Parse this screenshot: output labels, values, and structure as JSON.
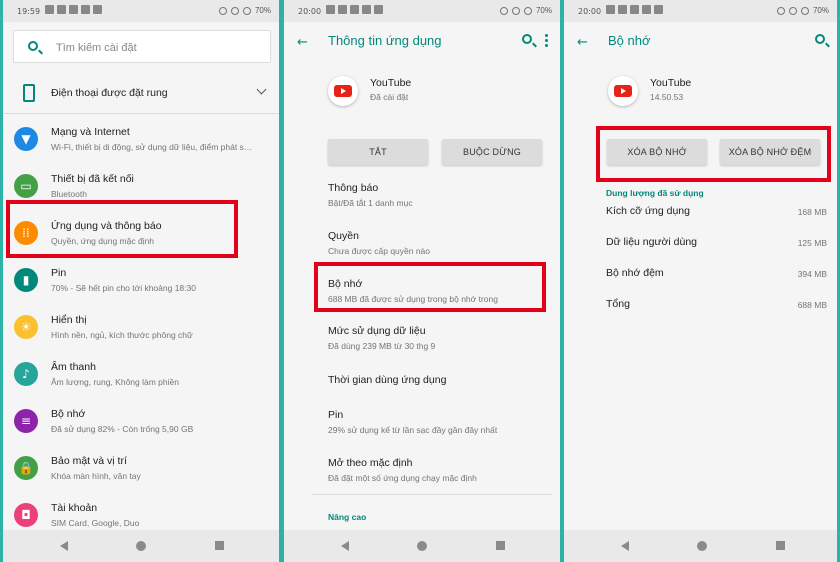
{
  "panel1": {
    "status": {
      "time": "19:59",
      "battery": "70%"
    },
    "search_placeholder": "Tìm kiếm cài đặt",
    "vibrate_label": "Điện thoại được đặt rung",
    "items": [
      {
        "title": "Mạng và Internet",
        "sub": "Wi-Fi, thiết bị di động, sử dụng dữ liệu, điểm phát s…",
        "color": "#1e88e5",
        "icon": "wifi-icon",
        "glyph": "▼"
      },
      {
        "title": "Thiết bị đã kết nối",
        "sub": "Bluetooth",
        "color": "#43a047",
        "icon": "devices-icon",
        "glyph": "▭"
      },
      {
        "title": "Ứng dụng và thông báo",
        "sub": "Quyền, ứng dụng mặc định",
        "color": "#fb8c00",
        "icon": "apps-icon",
        "glyph": "⁞⁞"
      },
      {
        "title": "Pin",
        "sub": "70% - Sẽ hết pin cho tới khoảng 18:30",
        "color": "#00897b",
        "icon": "battery-icon",
        "glyph": "▮"
      },
      {
        "title": "Hiển thị",
        "sub": "Hình nền, ngủ, kích thước phông chữ",
        "color": "#fbc02d",
        "icon": "display-icon",
        "glyph": "☀"
      },
      {
        "title": "Âm thanh",
        "sub": "Âm lượng, rung, Không làm phiền",
        "color": "#26a69a",
        "icon": "sound-icon",
        "glyph": "♪"
      },
      {
        "title": "Bộ nhớ",
        "sub": "Đã sử dụng 82% - Còn trống 5,90 GB",
        "color": "#8e24aa",
        "icon": "storage-icon",
        "glyph": "≡"
      },
      {
        "title": "Bảo mật và vị trí",
        "sub": "Khóa màn hình, vân tay",
        "color": "#43a047",
        "icon": "lock-icon",
        "glyph": "🔒"
      },
      {
        "title": "Tài khoản",
        "sub": "SIM Card, Google, Duo",
        "color": "#ec407a",
        "icon": "account-icon",
        "glyph": "◘"
      }
    ]
  },
  "panel2": {
    "status": {
      "time": "20:00",
      "battery": "70%"
    },
    "title": "Thông tin ứng dụng",
    "app_name": "YouTube",
    "app_status": "Đã cài đặt",
    "btn_disable": "TẮT",
    "btn_force_stop": "BUỘC DỪNG",
    "rows": [
      {
        "title": "Thông báo",
        "sub": "Bật/Đã tắt 1 danh mục"
      },
      {
        "title": "Quyền",
        "sub": "Chưa được cấp quyền nào"
      },
      {
        "title": "Bộ nhớ",
        "sub": "688 MB đã được sử dụng trong bộ nhớ trong"
      },
      {
        "title": "Mức sử dụng dữ liệu",
        "sub": "Đã dùng 239 MB từ 30 thg 9"
      },
      {
        "title": "Thời gian dùng ứng dụng",
        "sub": ""
      },
      {
        "title": "Pin",
        "sub": "29% sử dụng kể từ lần sạc đầy gần đây nhất"
      },
      {
        "title": "Mở theo mặc định",
        "sub": "Đã đặt một số ứng dụng chạy mặc định"
      }
    ],
    "advanced": "Nâng cao"
  },
  "panel3": {
    "status": {
      "time": "20:00",
      "battery": "70%"
    },
    "title": "Bộ nhớ",
    "app_name": "YouTube",
    "app_version": "14.50.53",
    "btn_clear_storage": "XÓA BỘ NHỚ",
    "btn_clear_cache": "XÓA BỘ NHỚ ĐỆM",
    "section": "Dung lượng đã sử dụng",
    "rows": [
      {
        "k": "Kích cỡ ứng dụng",
        "v": "168 MB"
      },
      {
        "k": "Dữ liệu người dùng",
        "v": "125 MB"
      },
      {
        "k": "Bộ nhớ đệm",
        "v": "394 MB"
      },
      {
        "k": "Tổng",
        "v": "688 MB"
      }
    ]
  },
  "colors": {
    "accent": "#00897b",
    "highlight": "#e3001b",
    "background": "#2bb3a8"
  }
}
